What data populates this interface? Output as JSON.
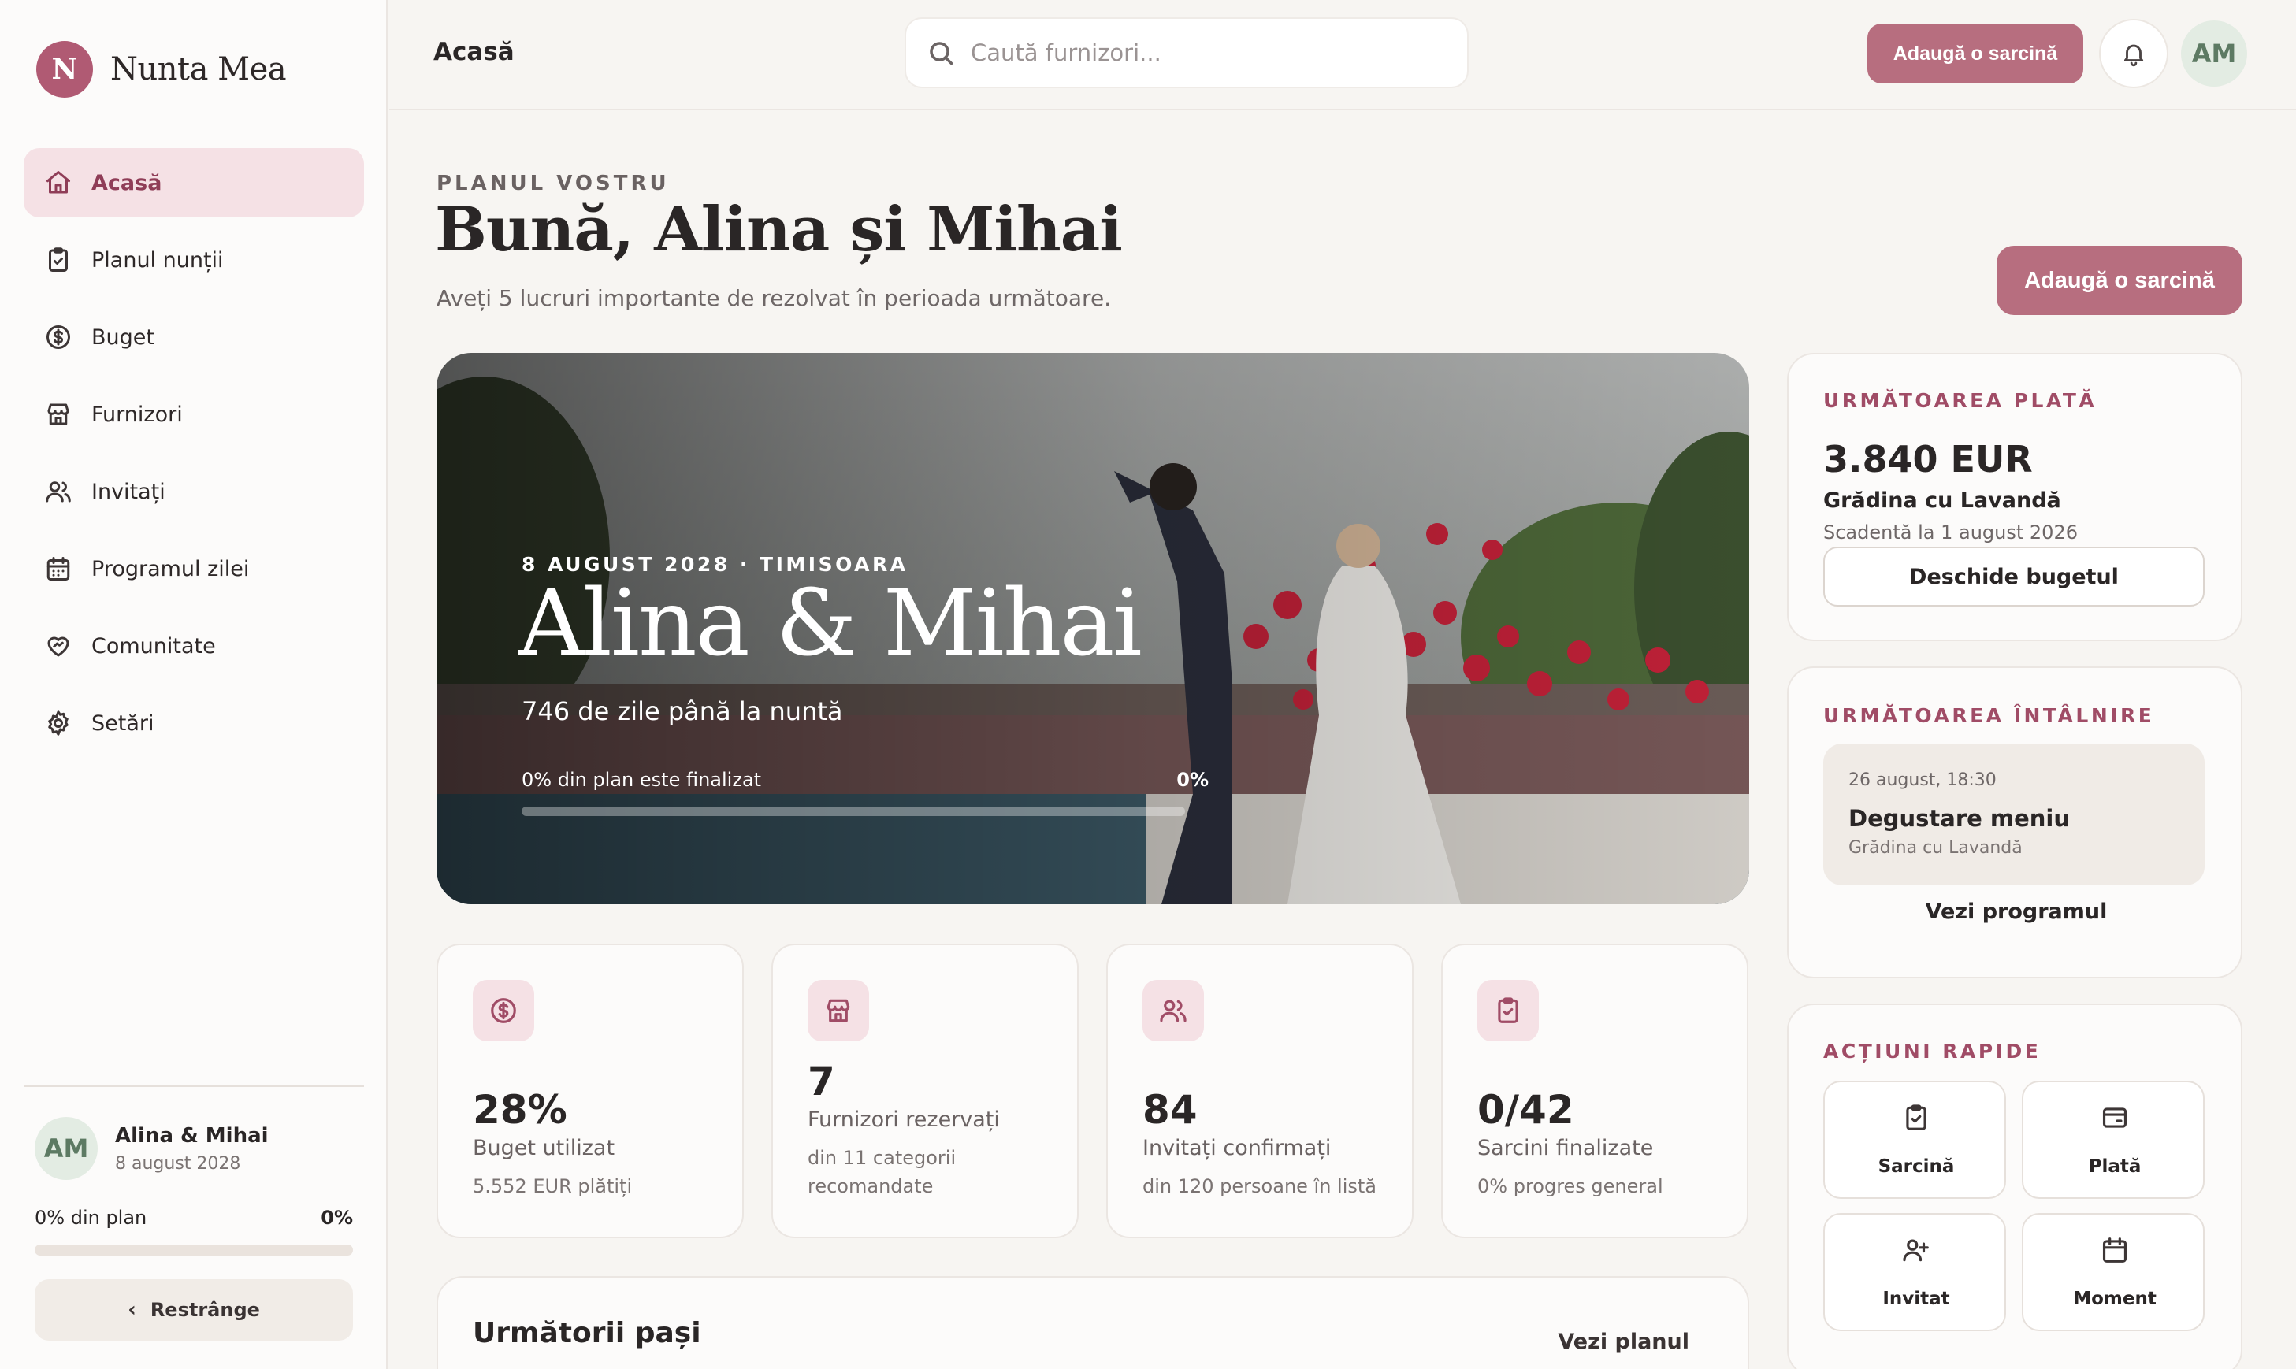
{
  "brand": {
    "initial": "N",
    "name": "Nunta Mea"
  },
  "sidebar": {
    "items": [
      {
        "label": "Acasă",
        "icon": "home-icon",
        "active": true
      },
      {
        "label": "Planul nunții",
        "icon": "clipboard-check-icon"
      },
      {
        "label": "Buget",
        "icon": "dollar-circle-icon"
      },
      {
        "label": "Furnizori",
        "icon": "store-icon"
      },
      {
        "label": "Invitați",
        "icon": "users-icon"
      },
      {
        "label": "Programul zilei",
        "icon": "calendar-icon"
      },
      {
        "label": "Comunitate",
        "icon": "heart-handshake-icon"
      },
      {
        "label": "Setări",
        "icon": "gear-icon"
      }
    ],
    "user": {
      "initials": "AM",
      "name": "Alina & Mihai",
      "date": "8 august 2028"
    },
    "plan_label": "0% din plan",
    "plan_pct": "0%",
    "plan_progress": 0,
    "collapse_label": "Restrânge"
  },
  "topbar": {
    "breadcrumb": "Acasă",
    "search_placeholder": "Caută furnizori...",
    "add_task": "Adaugă o sarcină",
    "avatar": "AM"
  },
  "header": {
    "eyebrow": "PLANUL VOSTRU",
    "greeting": "Bună, Alina și Mihai",
    "subtitle": "Aveți 5 lucruri importante de rezolvat în perioada următoare.",
    "add_task": "Adaugă o sarcină"
  },
  "hero": {
    "date_place": "8 AUGUST 2028 · TIMISOARA",
    "title": "Alina & Mihai",
    "days": "746 de zile până la nuntă",
    "plan_label": "0% din plan este finalizat",
    "plan_pct": "0%",
    "progress": 0
  },
  "stats": [
    {
      "icon": "dollar-circle-icon",
      "value": "28%",
      "label": "Buget utilizat",
      "meta": "5.552 EUR plătiți"
    },
    {
      "icon": "store-icon",
      "value": "7",
      "label": "Furnizori rezervați",
      "meta": "din 11 categorii recomandate"
    },
    {
      "icon": "users-icon",
      "value": "84",
      "label": "Invitați confirmați",
      "meta": "din 120 persoane în listă"
    },
    {
      "icon": "clipboard-check-icon",
      "value": "0/42",
      "label": "Sarcini finalizate",
      "meta": "0% progres general"
    }
  ],
  "next_steps": {
    "title": "Următorii pași",
    "link": "Vezi planul"
  },
  "payment": {
    "title": "URMĂTOAREA PLATĂ",
    "amount": "3.840 EUR",
    "vendor": "Grădina cu Lavandă",
    "due": "Scadentă la 1 august 2026",
    "button": "Deschide bugetul"
  },
  "meeting": {
    "title": "URMĂTOAREA ÎNTÂLNIRE",
    "time": "26 august, 18:30",
    "name": "Degustare meniu",
    "place": "Grădina cu Lavandă",
    "link": "Vezi programul"
  },
  "quick_actions": {
    "title": "ACȚIUNI RAPIDE",
    "items": [
      {
        "label": "Sarcină",
        "icon": "clipboard-check-icon"
      },
      {
        "label": "Plată",
        "icon": "wallet-icon"
      },
      {
        "label": "Invitat",
        "icon": "user-plus-icon"
      },
      {
        "label": "Moment",
        "icon": "calendar-icon"
      }
    ]
  },
  "colors": {
    "accent": "#b76e7f",
    "accent_dark": "#8f3d57",
    "accent_soft": "#f5e1e5"
  }
}
